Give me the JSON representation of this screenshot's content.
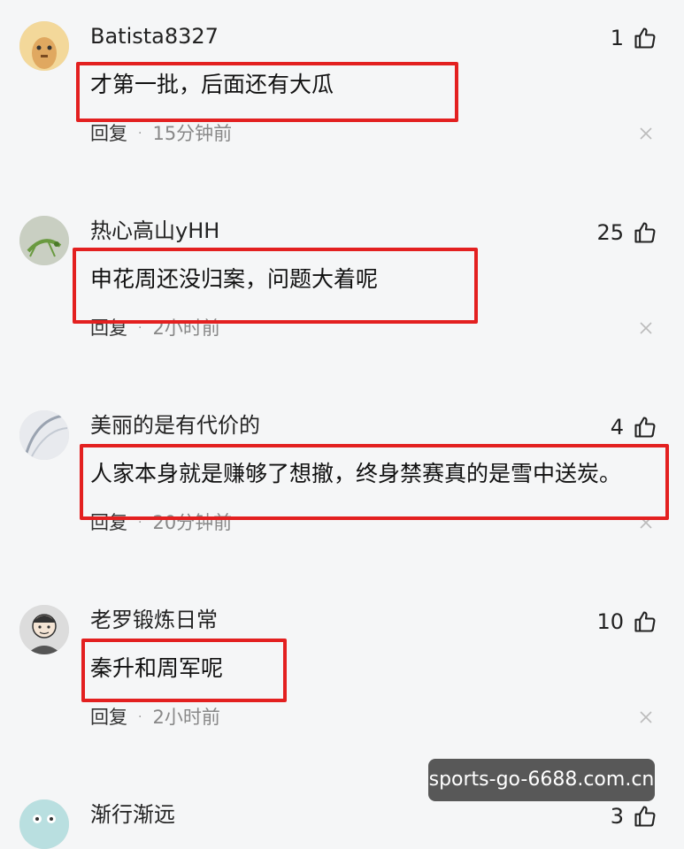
{
  "comments": [
    {
      "username": "Batista8327",
      "likes": "1",
      "content": "才第一批，后面还有大瓜",
      "reply": "回复",
      "dot": "·",
      "time": "15分钟前"
    },
    {
      "username": "热心高山yHH",
      "likes": "25",
      "content": "申花周还没归案，问题大着呢",
      "reply": "回复",
      "dot": "·",
      "time": "2小时前"
    },
    {
      "username": "美丽的是有代价的",
      "likes": "4",
      "content": "人家本身就是赚够了想撤，终身禁赛真的是雪中送炭。",
      "reply": "回复",
      "dot": "·",
      "time": "20分钟前"
    },
    {
      "username": "老罗锻炼日常",
      "likes": "10",
      "content": "秦升和周军呢",
      "reply": "回复",
      "dot": "·",
      "time": "2小时前"
    },
    {
      "username": "渐行渐远",
      "likes": "3"
    }
  ],
  "watermark": "sports-go-6688.com.cn",
  "colors": {
    "highlight": "#e32020",
    "background": "#f5f6f7"
  },
  "icons": {
    "like": "thumbs-up-icon",
    "close": "close-icon"
  }
}
